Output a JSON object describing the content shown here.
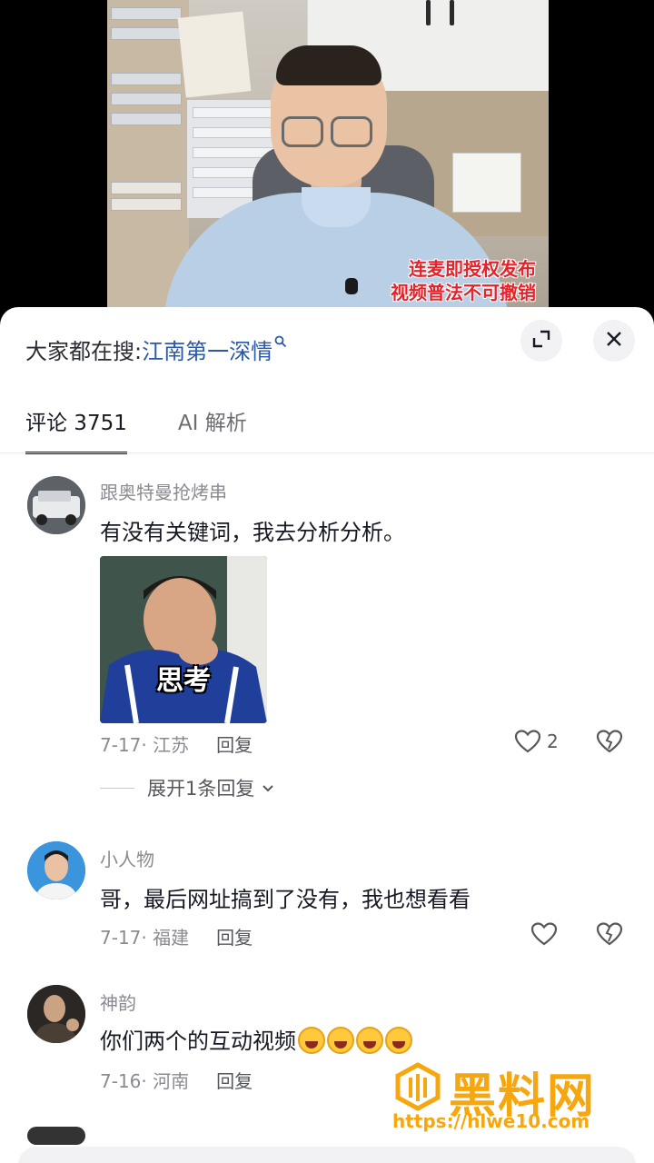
{
  "video": {
    "caption_line1": "连麦即授权发布",
    "caption_line2": "视频普法不可撤销"
  },
  "header": {
    "search_prefix": "大家都在搜:",
    "search_term": "江南第一深情",
    "search_icon": "search-icon",
    "expand_icon": "expand-icon",
    "close_icon": "close-icon"
  },
  "tabs": [
    {
      "label": "评论 3751",
      "active": true
    },
    {
      "label": "AI 解析",
      "active": false
    }
  ],
  "comments": [
    {
      "username": "跟奥特曼抢烤串",
      "text": "有没有关键词，我去分析分析。",
      "sticker_text": "思考",
      "date_location": "7-17· 江苏",
      "reply_label": "回复",
      "like_count": "2",
      "expand_label": "展开1条回复"
    },
    {
      "username": "小人物",
      "text": "哥，最后网址搞到了没有，我也想看看",
      "date_location": "7-17· 福建",
      "reply_label": "回复"
    },
    {
      "username": "神韵",
      "text": "你们两个的互动视频",
      "date_location": "7-16· 河南",
      "reply_label": "回复"
    }
  ],
  "watermark": {
    "title": "黑料网",
    "url": "https://hlwe10.com"
  },
  "colors": {
    "accent_link": "#2b58a8",
    "caption_red": "#e4232a",
    "watermark_orange": "#f6a70f"
  }
}
